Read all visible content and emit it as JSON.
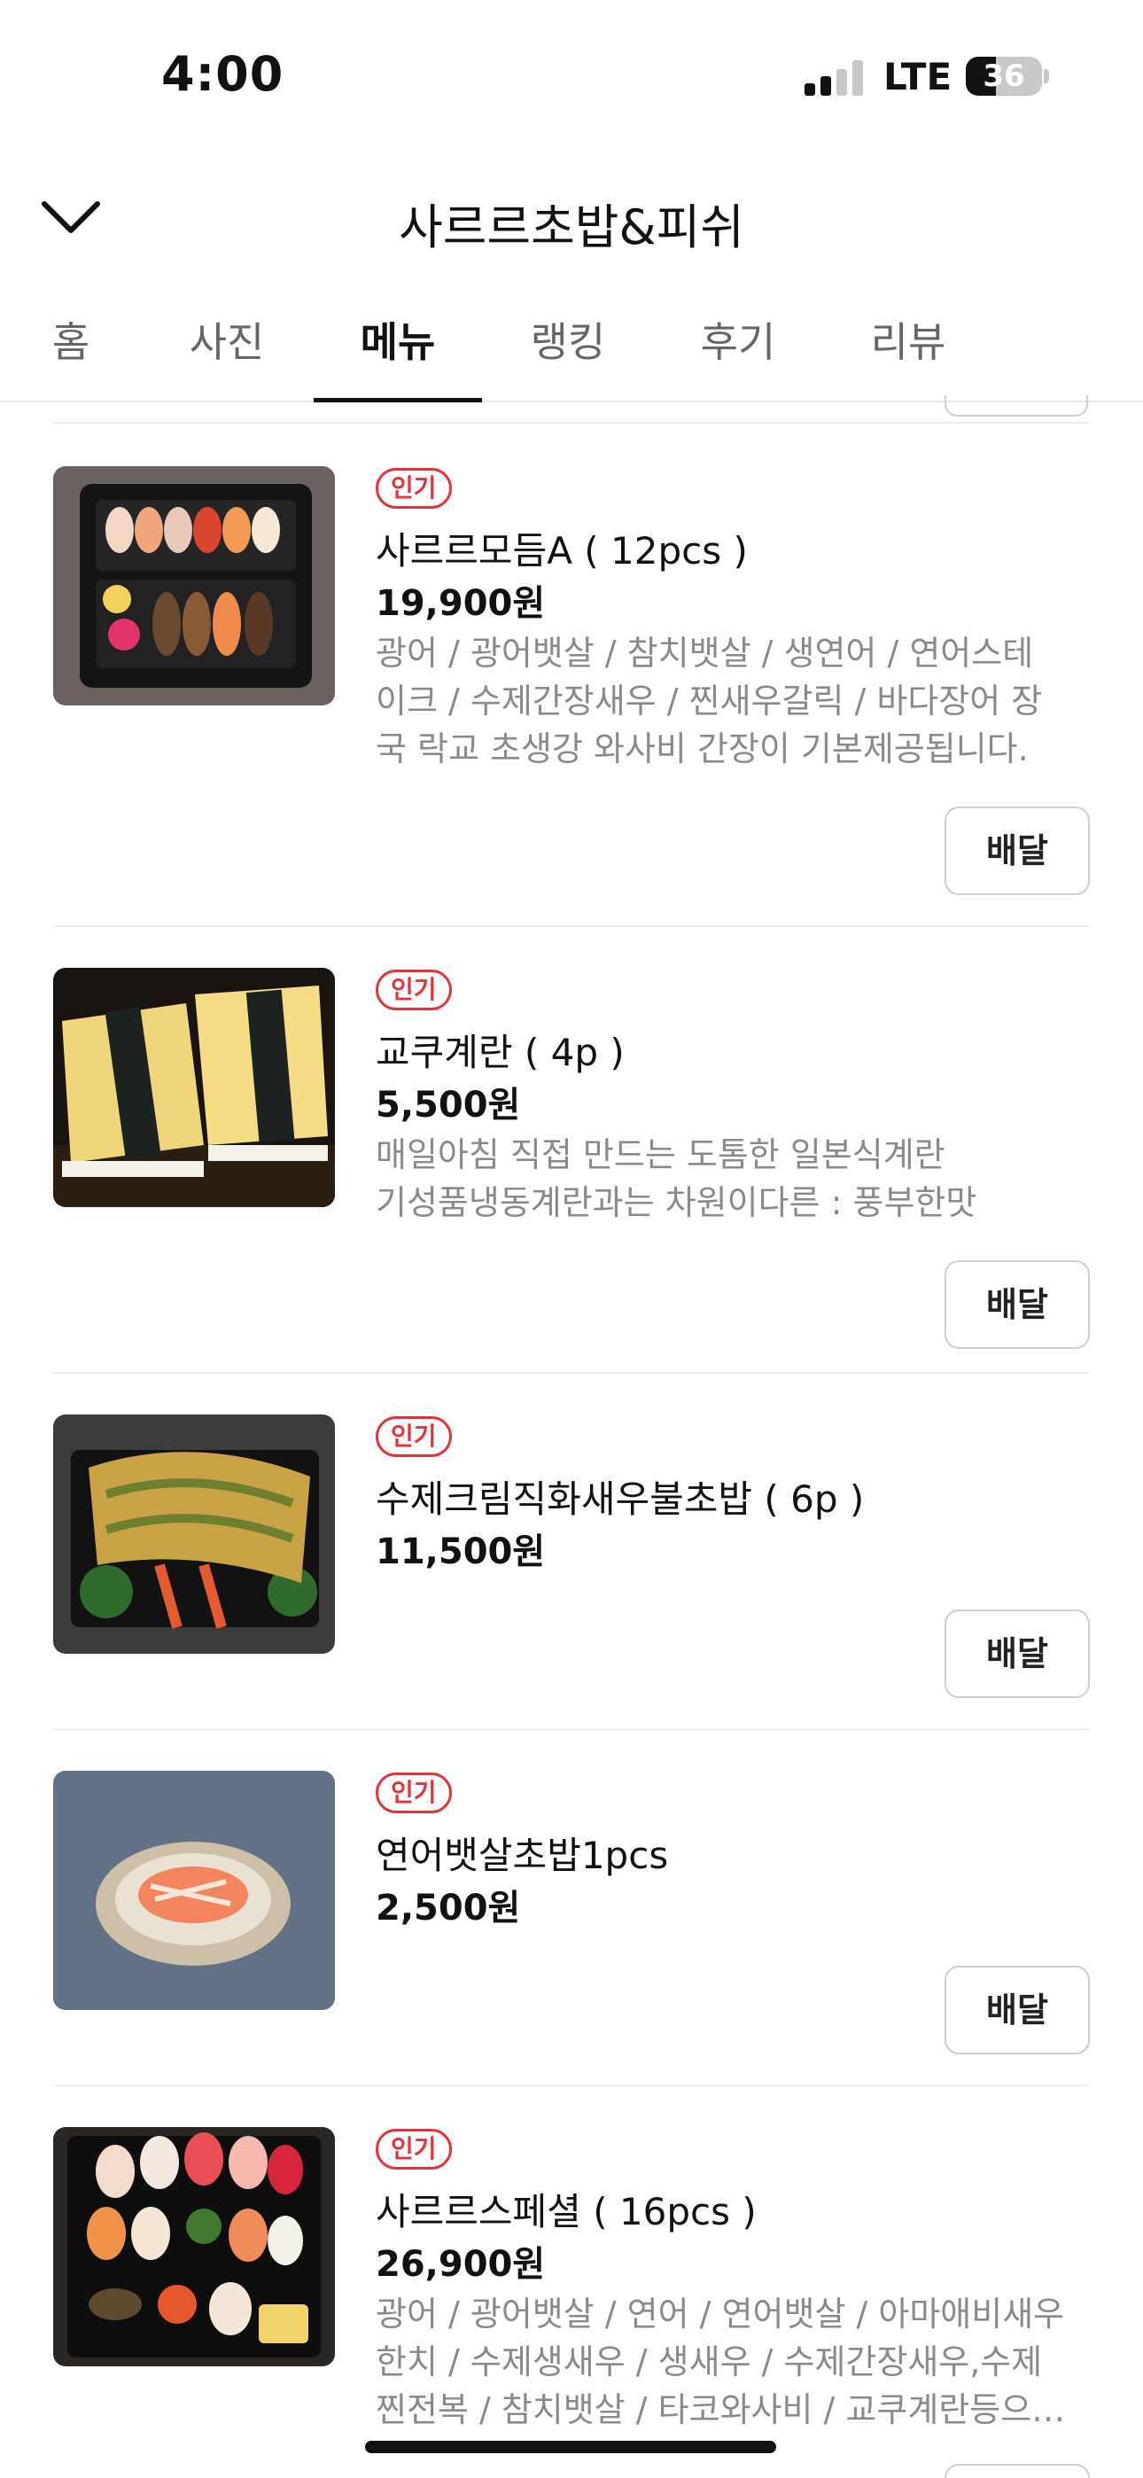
{
  "status_bar": {
    "time": "4:00",
    "network": "LTE",
    "battery": "36"
  },
  "header": {
    "back_icon": "chevron-down-icon",
    "title": "사르르초밥&피쉬"
  },
  "tabs": [
    {
      "label": "홈"
    },
    {
      "label": "사진"
    },
    {
      "label": "메뉴",
      "active": true
    },
    {
      "label": "랭킹"
    },
    {
      "label": "후기"
    },
    {
      "label": "리뷰"
    }
  ],
  "colors": {
    "badge": "#e3343b",
    "text": "#111111",
    "muted": "#8a8a8a",
    "border": "#cfcfcf"
  },
  "menu_items": [
    {
      "badge": "인기",
      "name": "사르르모듬A ( 12pcs )",
      "price": "19,900원",
      "description_lines": [
        "광어 / 광어뱃살 /  참치뱃살 / 생연어 / 연어스테",
        "이크 / 수제간장새우 / 찐새우갈릭 / 바다장어  장",
        "국 락교 초생강 와사비 간장이 기본제공됩니다."
      ],
      "button": "배달"
    },
    {
      "badge": "인기",
      "name": "교쿠계란 ( 4p )",
      "price": "5,500원",
      "description_lines": [
        "매일아침 직접 만드는 도톰한 일본식계란",
        "기성품냉동계란과는 차원이다른 : 풍부한맛"
      ],
      "button": "배달"
    },
    {
      "badge": "인기",
      "name": "수제크림직화새우불초밥 ( 6p )",
      "price": "11,500원",
      "description_lines": [],
      "button": "배달"
    },
    {
      "badge": "인기",
      "name": "연어뱃살초밥1pcs",
      "price": "2,500원",
      "description_lines": [],
      "button": "배달"
    },
    {
      "badge": "인기",
      "name": "사르르스페셜 ( 16pcs )",
      "price": "26,900원",
      "description_lines": [
        "광어 / 광어뱃살 / 연어 / 연어뱃살 / 아마애비새우",
        "한치 / 수제생새우 / 생새우 / 수제간장새우,수제",
        "찐전복 / 참치뱃살 / 타코와사비 / 교쿠계란등으…"
      ],
      "button": "배달"
    }
  ]
}
